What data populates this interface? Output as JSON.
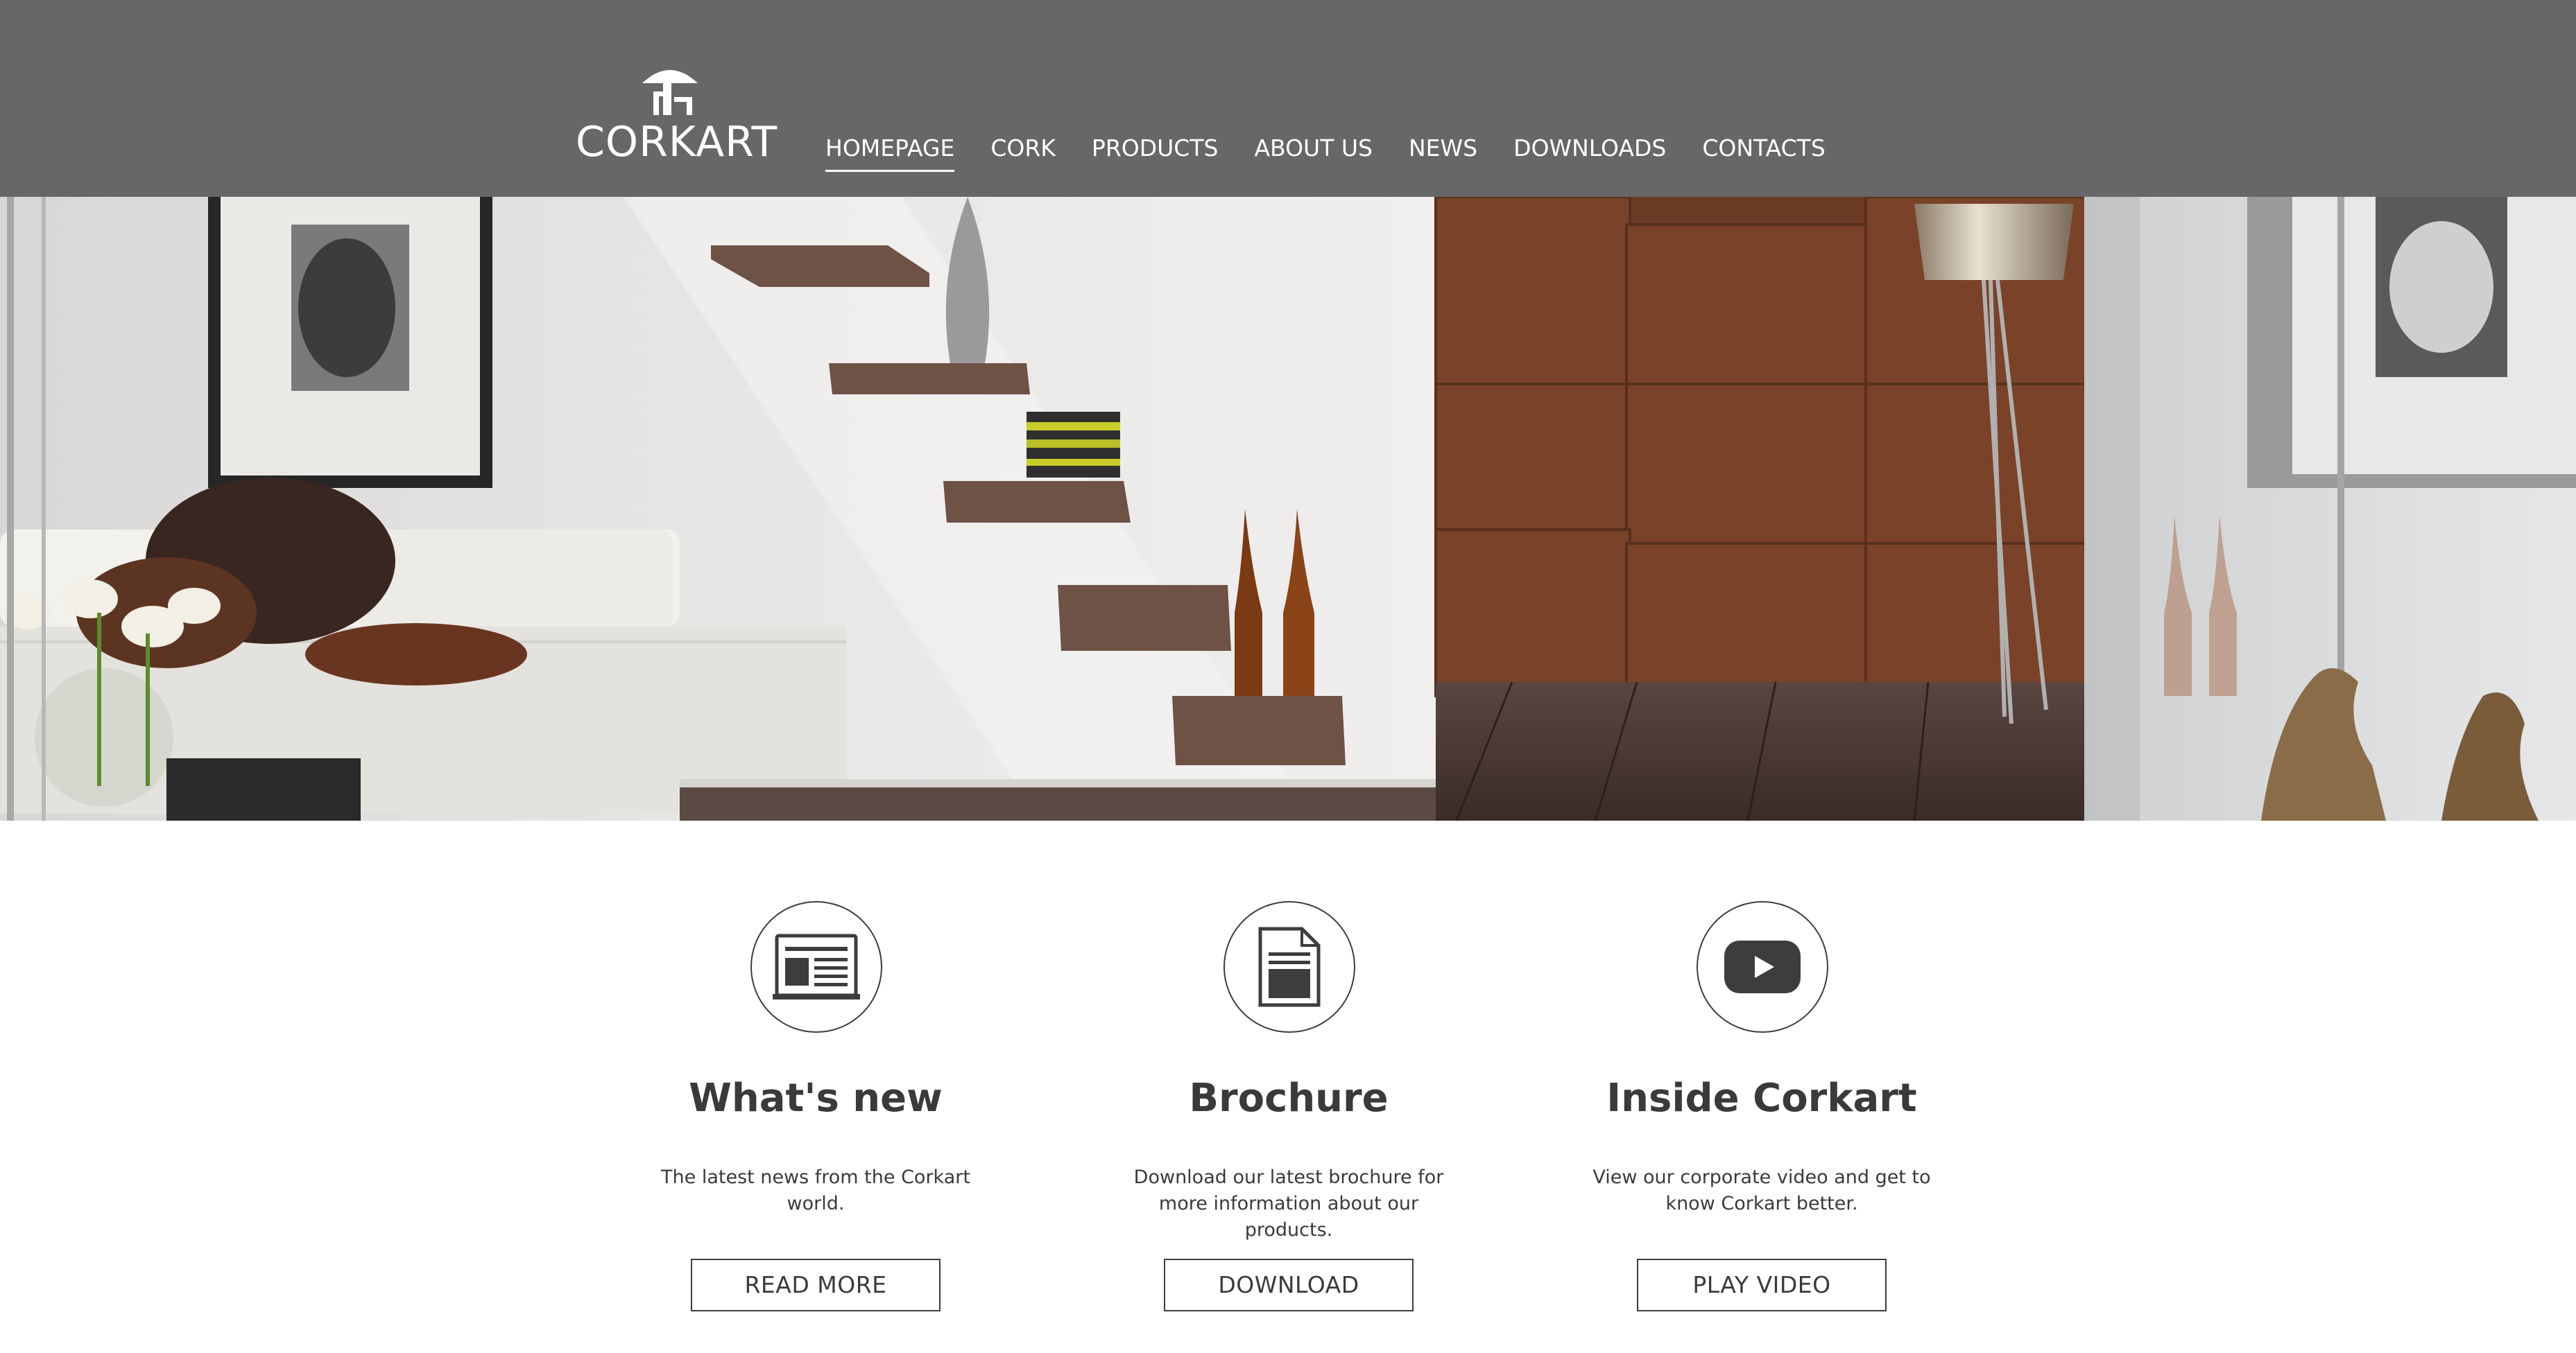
{
  "brand": {
    "name": "CORKART",
    "logo_icon": "mushroom-logo-icon"
  },
  "nav": {
    "items": [
      {
        "label": "HOMEPAGE",
        "active": true
      },
      {
        "label": "CORK",
        "active": false
      },
      {
        "label": "PRODUCTS",
        "active": false
      },
      {
        "label": "ABOUT US",
        "active": false
      },
      {
        "label": "NEWS",
        "active": false
      },
      {
        "label": "DOWNLOADS",
        "active": false
      },
      {
        "label": "CONTACTS",
        "active": false
      }
    ]
  },
  "hero": {
    "image": "living-room-interior-photo"
  },
  "features": [
    {
      "icon": "newspaper-icon",
      "title": "What's new",
      "description": "The latest news from the Corkart world.",
      "button": "READ MORE"
    },
    {
      "icon": "document-icon",
      "title": "Brochure",
      "description": "Download our latest brochure for more information about our products.",
      "button": "DOWNLOAD"
    },
    {
      "icon": "play-video-icon",
      "title": "Inside Corkart",
      "description": "View our corporate video and get to know Corkart better.",
      "button": "PLAY VIDEO"
    }
  ],
  "colors": {
    "header_bg": "#666769",
    "text": "#3a3a3a",
    "accent_brown": "#7a3f22"
  }
}
